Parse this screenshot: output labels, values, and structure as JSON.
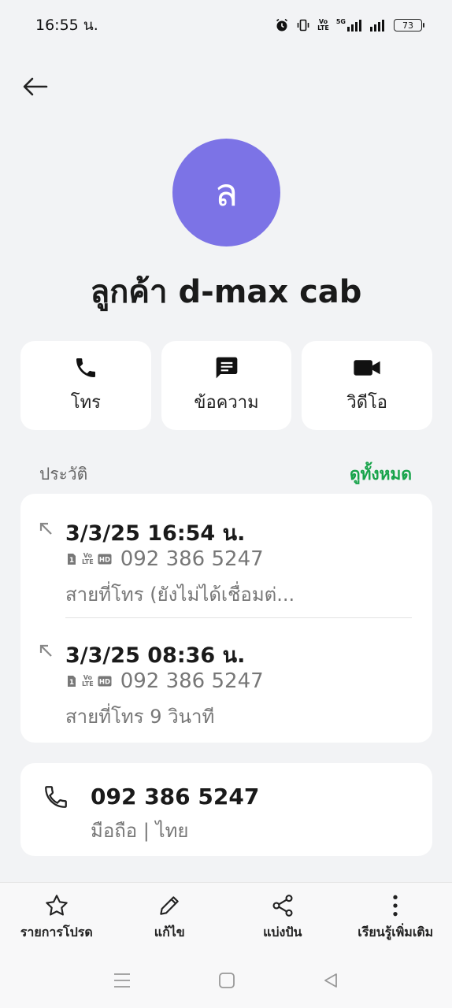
{
  "status_bar": {
    "time": "16:55 น.",
    "battery": "73",
    "volte_top": "Vo",
    "volte_bottom": "LTE",
    "network": "5G"
  },
  "contact": {
    "avatar_letter": "ล",
    "avatar_color": "#7c73e6",
    "name": "ลูกค้า d-max cab"
  },
  "actions": {
    "call_label": "โทร",
    "message_label": "ข้อความ",
    "video_label": "วิดีโอ"
  },
  "history": {
    "title": "ประวัติ",
    "view_all": "ดูทั้งหมด",
    "view_all_color": "#17a34a",
    "entries": [
      {
        "datetime": "3/3/25 16:54 น.",
        "sim": "1",
        "volte_top": "Vo",
        "volte_bottom": "LTE",
        "hd": "HD",
        "number": "092 386 5247",
        "description": "สายที่โทร (ยังไม่ได้เชื่อมต่..."
      },
      {
        "datetime": "3/3/25 08:36 น.",
        "sim": "1",
        "volte_top": "Vo",
        "volte_bottom": "LTE",
        "hd": "HD",
        "number": "092 386 5247",
        "description": "สายที่โทร  9 วินาที"
      }
    ]
  },
  "phone": {
    "number": "092 386 5247",
    "meta": "มือถือ  |  ไทย"
  },
  "toolbar": {
    "favorite_label": "รายการโปรด",
    "edit_label": "แก้ไข",
    "share_label": "แบ่งปัน",
    "more_label": "เรียนรู้เพิ่มเติม"
  }
}
